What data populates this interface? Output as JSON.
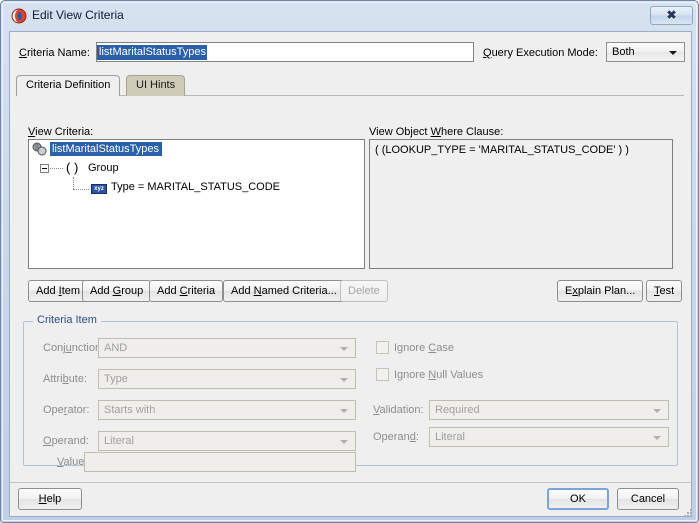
{
  "window": {
    "title": "Edit View Criteria",
    "icon": "jdeveloper-app-icon",
    "close_glyph": "✖"
  },
  "top": {
    "criteria_name_label": "Criteria Name:",
    "criteria_name_value": "listMaritalStatusTypes",
    "query_execution_mode_label": "Query Execution Mode:",
    "query_execution_mode_value": "Both"
  },
  "tabs": [
    {
      "label": "Criteria Definition",
      "active": true
    },
    {
      "label": "UI Hints",
      "active": false
    }
  ],
  "panels": {
    "view_criteria_label": "View Criteria:",
    "where_clause_label": "View Object Where Clause:",
    "where_clause_text": "( (LOOKUP_TYPE = 'MARITAL_STATUS_CODE' ) )"
  },
  "tree": {
    "root_label": "listMaritalStatusTypes",
    "group_paren": "( )",
    "group_label": "Group",
    "item_icon_text": "xyz",
    "item_label": "Type = MARITAL_STATUS_CODE"
  },
  "actions": {
    "add_item": "Add Item",
    "add_group": "Add Group",
    "add_criteria": "Add Criteria",
    "add_named_criteria": "Add Named Criteria...",
    "delete": "Delete",
    "explain_plan": "Explain Plan...",
    "test": "Test"
  },
  "criteria_item": {
    "group_title": "Criteria Item",
    "conjunction_label": "Conjunction:",
    "conjunction_value": "AND",
    "attribute_label": "Attribute:",
    "attribute_value": "Type",
    "operator_label": "Operator:",
    "operator_value": "Starts with",
    "operand_left_label": "Operand:",
    "operand_left_value": "Literal",
    "value_label": "Value:",
    "value_value": "",
    "ignore_case_label": "Ignore Case",
    "ignore_null_label": "Ignore Null Values",
    "validation_label": "Validation:",
    "validation_value": "Required",
    "operand_right_label": "Operand:",
    "operand_right_value": "Literal"
  },
  "footer": {
    "help": "Help",
    "ok": "OK",
    "cancel": "Cancel"
  },
  "colors": {
    "selection_blue": "#2a5faa",
    "group_title_blue": "#2a4f86",
    "window_frame": "#bfd0e6",
    "client_bg": "#efefef",
    "default_button_focus": "#7aa5d8"
  }
}
